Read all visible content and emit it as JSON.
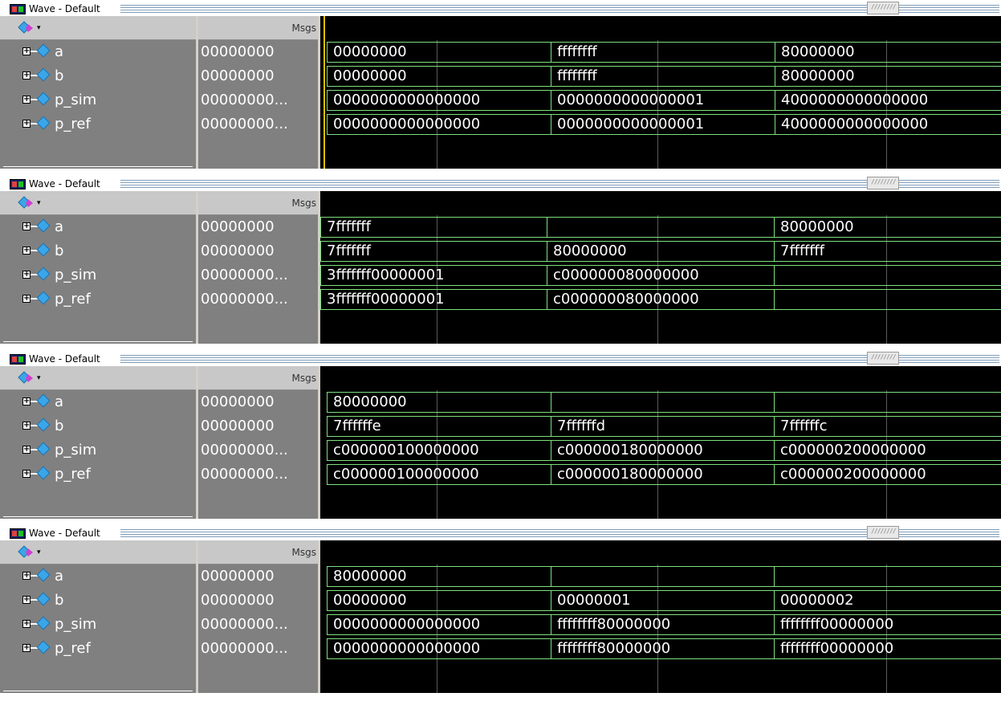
{
  "panels": [
    {
      "title": "Wave - Default",
      "msgs_label": "Msgs",
      "signals": [
        {
          "name": "a",
          "msg": "00000000",
          "segments": [
            "00000000",
            "ffffffff",
            "80000000"
          ]
        },
        {
          "name": "b",
          "msg": "00000000",
          "segments": [
            "00000000",
            "ffffffff",
            "80000000"
          ]
        },
        {
          "name": "p_sim",
          "msg": "00000000...",
          "segments": [
            "0000000000000000",
            "0000000000000001",
            "4000000000000000"
          ]
        },
        {
          "name": "p_ref",
          "msg": "00000000...",
          "segments": [
            "0000000000000000",
            "0000000000000001",
            "4000000000000000"
          ]
        }
      ]
    },
    {
      "title": "Wave - Default",
      "msgs_label": "Msgs",
      "signals": [
        {
          "name": "a",
          "msg": "00000000",
          "segments": [
            "7fffffff",
            "",
            "80000000"
          ]
        },
        {
          "name": "b",
          "msg": "00000000",
          "segments": [
            "7fffffff",
            "80000000",
            "7fffffff"
          ]
        },
        {
          "name": "p_sim",
          "msg": "00000000...",
          "segments": [
            "3fffffff00000001",
            "c000000080000000",
            ""
          ]
        },
        {
          "name": "p_ref",
          "msg": "00000000...",
          "segments": [
            "3fffffff00000001",
            "c000000080000000",
            ""
          ]
        }
      ]
    },
    {
      "title": "Wave - Default",
      "msgs_label": "Msgs",
      "signals": [
        {
          "name": "a",
          "msg": "00000000",
          "segments": [
            "80000000",
            "",
            ""
          ]
        },
        {
          "name": "b",
          "msg": "00000000",
          "segments": [
            "7ffffffe",
            "7ffffffd",
            "7ffffffc"
          ]
        },
        {
          "name": "p_sim",
          "msg": "00000000...",
          "segments": [
            "c000000100000000",
            "c000000180000000",
            "c000000200000000"
          ]
        },
        {
          "name": "p_ref",
          "msg": "00000000...",
          "segments": [
            "c000000100000000",
            "c000000180000000",
            "c000000200000000"
          ]
        }
      ]
    },
    {
      "title": "Wave - Default",
      "msgs_label": "Msgs",
      "signals": [
        {
          "name": "a",
          "msg": "00000000",
          "segments": [
            "80000000",
            "",
            ""
          ]
        },
        {
          "name": "b",
          "msg": "00000000",
          "segments": [
            "00000000",
            "00000001",
            "00000002"
          ]
        },
        {
          "name": "p_sim",
          "msg": "00000000...",
          "segments": [
            "0000000000000000",
            "ffffffff80000000",
            "ffffffff00000000"
          ]
        },
        {
          "name": "p_ref",
          "msg": "00000000...",
          "segments": [
            "0000000000000000",
            "ffffffff80000000",
            "ffffffff00000000"
          ]
        }
      ]
    }
  ],
  "colors": {
    "bus": "#7ee07e",
    "wave_bg": "#000000",
    "signal_panel": "#808080",
    "cursor": "#e0c000"
  },
  "icons": [
    "wave-window-icon",
    "expand-plus-icon",
    "signal-diamond-icon",
    "toolbar-diamond-icon",
    "dropdown-arrow-icon"
  ]
}
